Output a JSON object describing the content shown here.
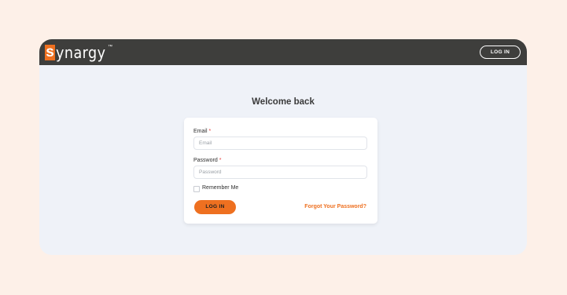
{
  "header": {
    "logo_letter": "s",
    "logo_rest": "ynargy",
    "logo_mark": "™",
    "login_label": "LOG IN"
  },
  "page": {
    "title": "Welcome back"
  },
  "form": {
    "email_label": "Email",
    "email_placeholder": "Email",
    "password_label": "Password",
    "password_placeholder": "Password",
    "required_mark": "*",
    "remember_label": "Remember Me",
    "submit_label": "LOG IN",
    "forgot_label": "Forgot Your Password?"
  },
  "colors": {
    "accent": "#ee7020",
    "topbar": "#3e3e3c",
    "background": "#fdf0e8",
    "content_bg": "#eff2f8"
  }
}
